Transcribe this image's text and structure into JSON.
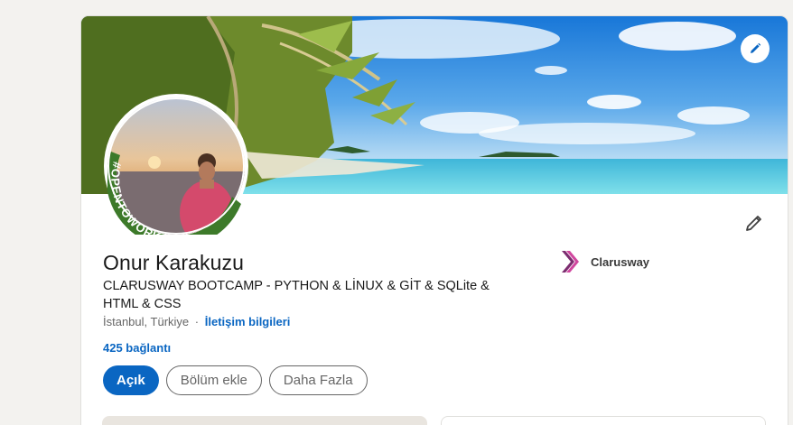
{
  "profile": {
    "name": "Onur Karakuzu",
    "headline": "CLARUSWAY BOOTCAMP - PYTHON & LİNUX & GİT & SQLite & HTML & CSS",
    "location": "İstanbul, Türkiye",
    "separator": "·",
    "contact_info": "İletişim bilgileri",
    "connections": "425 bağlantı",
    "open_to_work_badge": "#OPENTOWORK"
  },
  "actions": {
    "primary": "Açık",
    "add_section": "Bölüm ekle",
    "more": "Daha Fazla"
  },
  "company": {
    "name": "Clarusway",
    "logo_icon": "clarusway-logo-icon"
  },
  "icons": {
    "cover_edit": "pencil-icon",
    "profile_edit": "pencil-icon"
  },
  "colors": {
    "link_blue": "#0a66c2",
    "open_to_work_green": "#3d7a2a",
    "company_logo_pink": "#d0479e",
    "page_background": "#f3f2ef"
  }
}
